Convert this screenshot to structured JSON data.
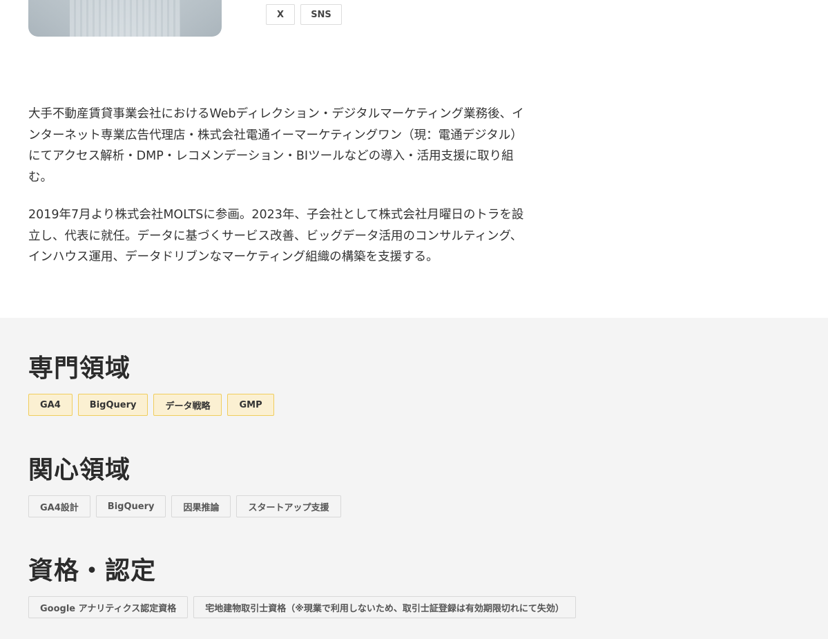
{
  "social": {
    "buttons": [
      "X",
      "SNS"
    ]
  },
  "bio": {
    "paragraphs": [
      "大手不動産賃貸事業会社におけるWebディレクション・デジタルマーケティング業務後、インターネット専業広告代理店・株式会社電通イーマーケティングワン（現：電通デジタル）にてアクセス解析・DMP・レコメンデーション・BIツールなどの導入・活用支援に取り組む。",
      "2019年7月より株式会社MOLTSに参画。2023年、子会社として株式会社月曜日のトラを設立し、代表に就任。データに基づくサービス改善、ビッグデータ活用のコンサルティング、インハウス運用、データドリブンなマーケティング組織の構築を支援する。"
    ]
  },
  "expertise": {
    "title": "専門領域",
    "tags": [
      "GA4",
      "BigQuery",
      "データ戦略",
      "GMP"
    ]
  },
  "interests": {
    "title": "関心領域",
    "tags": [
      "GA4設計",
      "BigQuery",
      "因果推論",
      "スタートアップ支援"
    ]
  },
  "certifications": {
    "title": "資格・認定",
    "tags": [
      "Google アナリティクス認定資格",
      "宅地建物取引士資格（※現業で利用しないため、取引士証登録は有効期限切れにて失効）"
    ]
  },
  "colors": {
    "highlight_tag_bg": "#fbf0d2",
    "highlight_tag_border": "#f0cd5c",
    "section_bg": "#f4f4f4"
  }
}
